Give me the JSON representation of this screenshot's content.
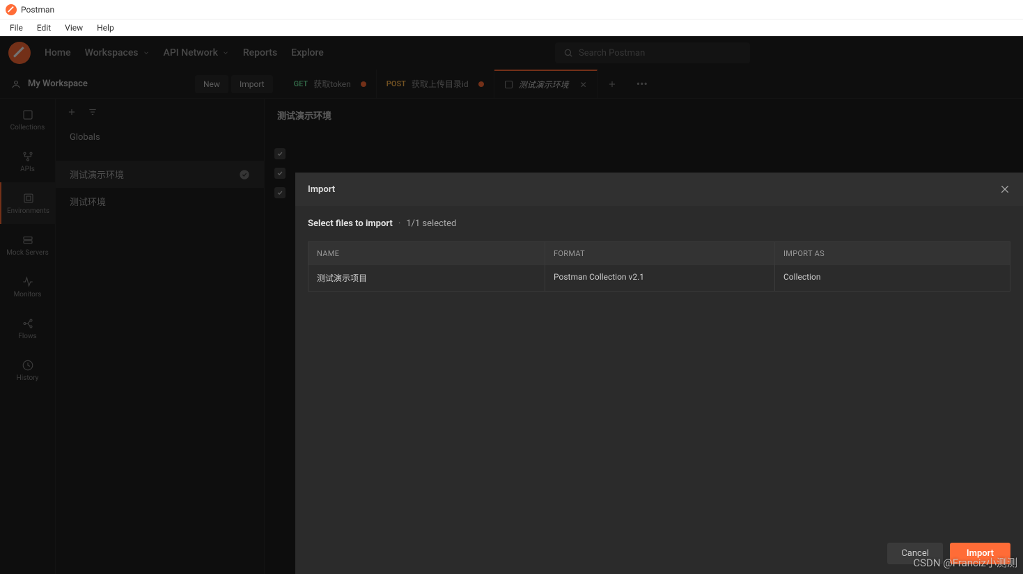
{
  "titlebar": {
    "app_name": "Postman"
  },
  "menubar": {
    "items": [
      "File",
      "Edit",
      "View",
      "Help"
    ]
  },
  "topnav": {
    "links": [
      "Home",
      "Workspaces",
      "API Network",
      "Reports",
      "Explore"
    ],
    "search_placeholder": "Search Postman"
  },
  "subheader": {
    "workspace": "My Workspace",
    "new_label": "New",
    "import_label": "Import"
  },
  "tabs": [
    {
      "method": "GET",
      "label": "获取token",
      "dirty": true
    },
    {
      "method": "POST",
      "label": "获取上传目录id",
      "dirty": true
    },
    {
      "env": true,
      "label": "测试演示环境",
      "active": true
    }
  ],
  "sidebar_icons": [
    {
      "label": "Collections"
    },
    {
      "label": "APIs"
    },
    {
      "label": "Environments",
      "active": true
    },
    {
      "label": "Mock Servers"
    },
    {
      "label": "Monitors"
    },
    {
      "label": "Flows"
    },
    {
      "label": "History"
    }
  ],
  "sidebar_envs": {
    "globals": "Globals",
    "items": [
      {
        "name": "测试演示环境",
        "active": true,
        "checked": true
      },
      {
        "name": "测试环境",
        "active": false
      }
    ]
  },
  "content": {
    "env_title": "测试演示环境"
  },
  "modal": {
    "title": "Import",
    "subhead": "Select files to import",
    "selected_count": "1/1 selected",
    "columns": {
      "name": "NAME",
      "format": "FORMAT",
      "import_as": "IMPORT AS"
    },
    "rows": [
      {
        "name": "测试演示项目",
        "format": "Postman Collection v2.1",
        "import_as": "Collection"
      }
    ],
    "cancel_label": "Cancel",
    "import_label": "Import"
  },
  "watermark": "CSDN @Franciz小测测"
}
